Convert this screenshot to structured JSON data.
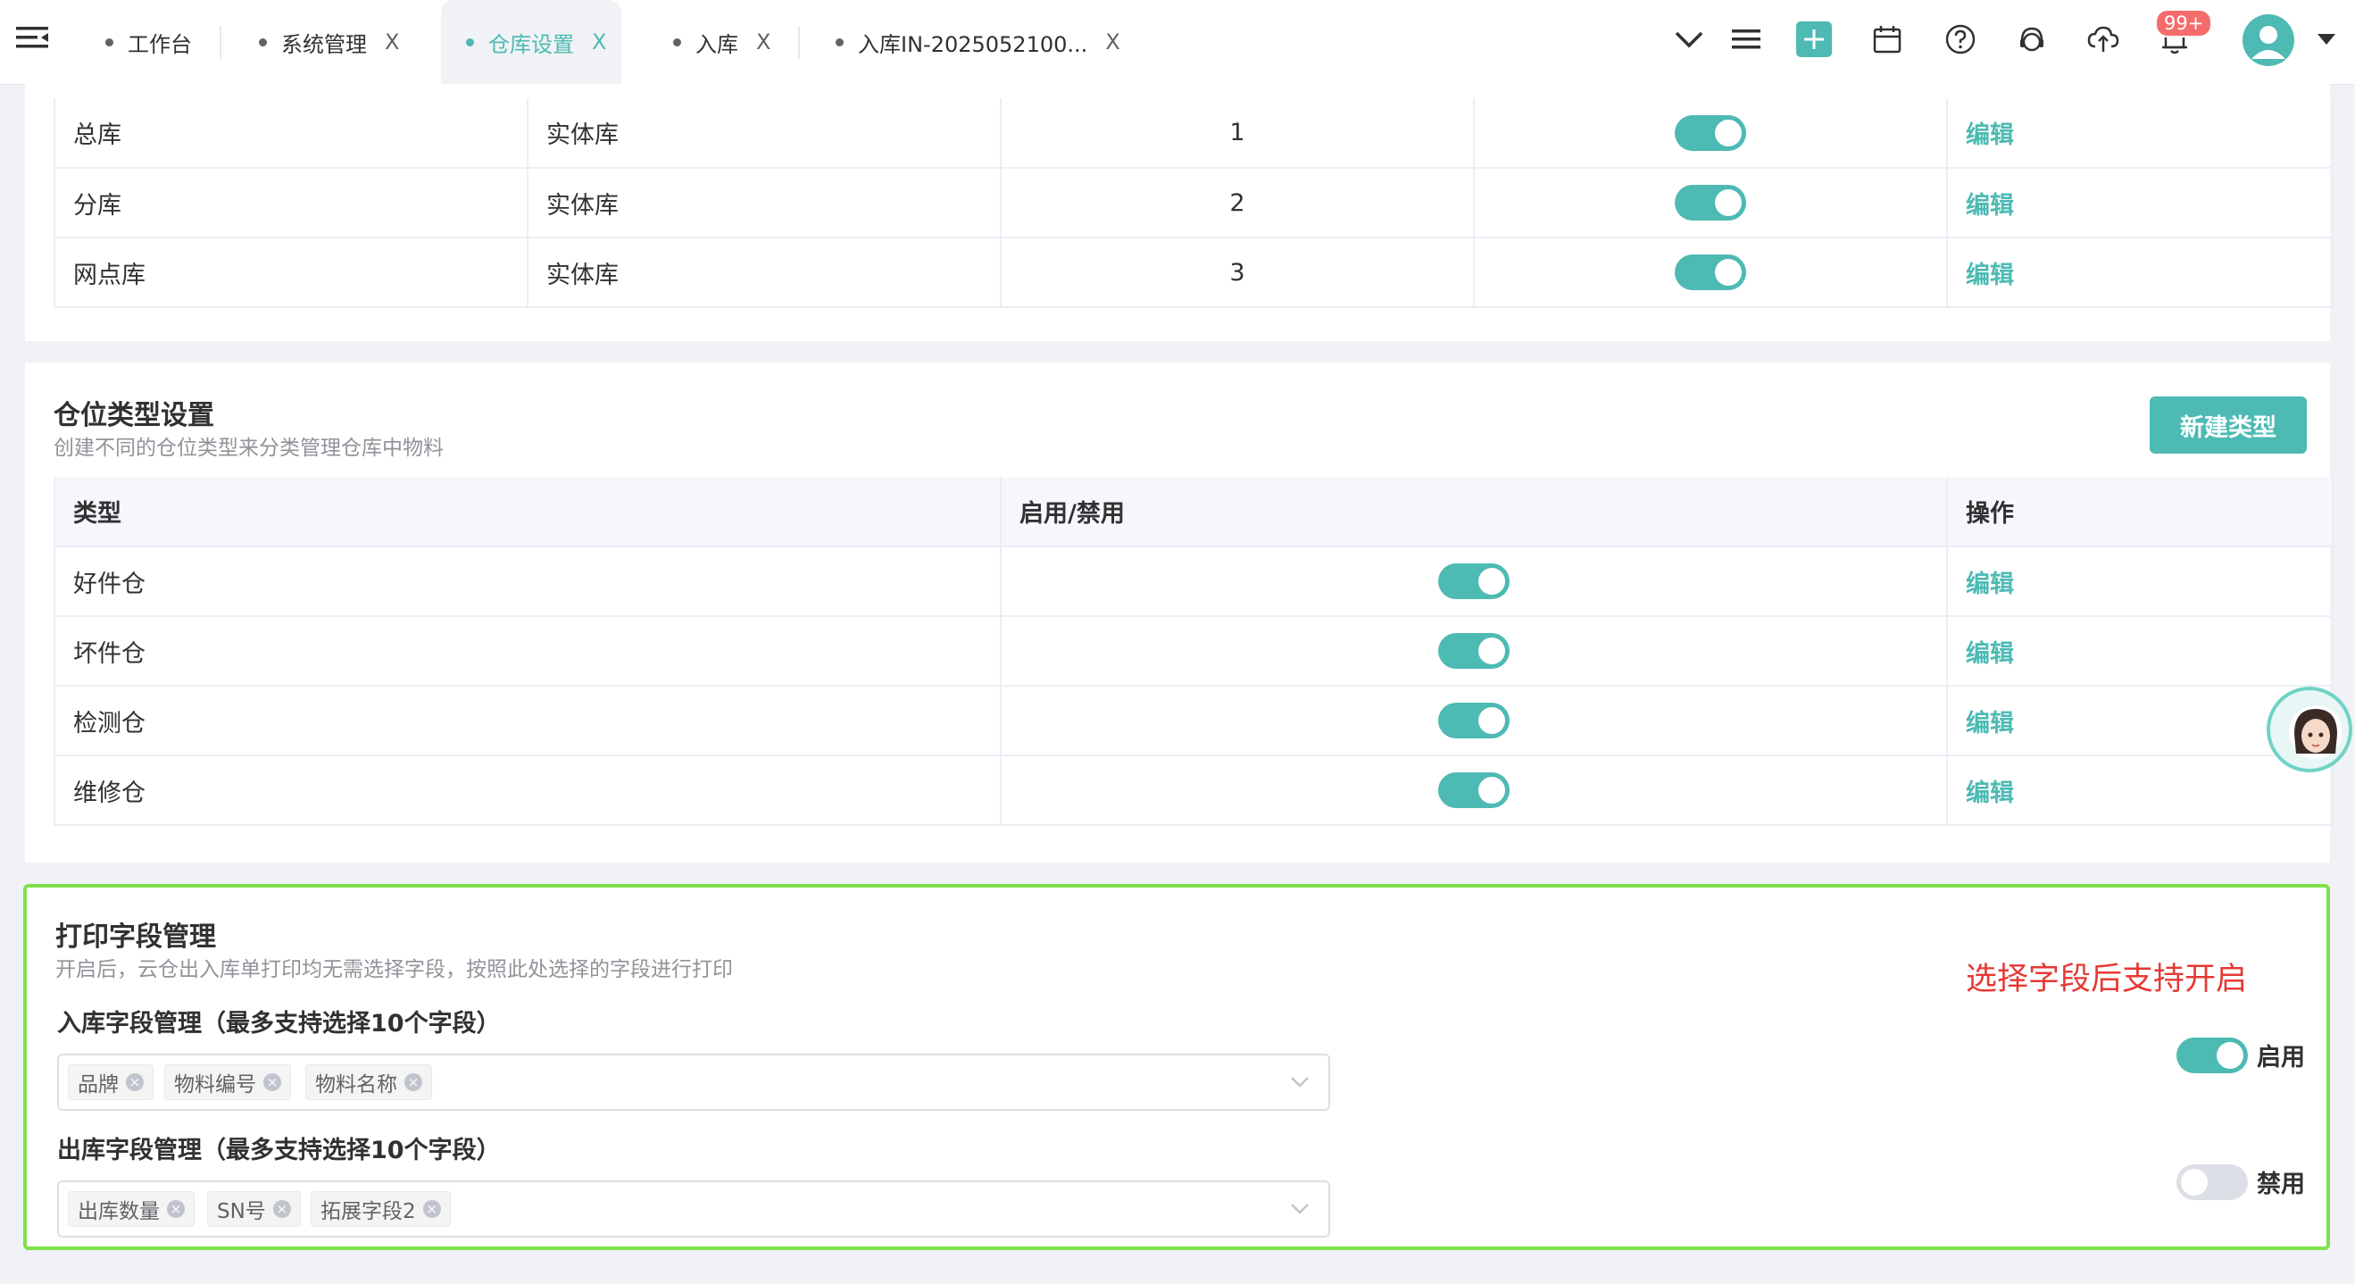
{
  "colors": {
    "accent": "#4dbab3",
    "highlight_border": "#7ee04b",
    "note_red": "#e53935",
    "badge_red": "#f56c6c"
  },
  "tabs": [
    {
      "label": "工作台",
      "closable": false,
      "active": false
    },
    {
      "label": "系统管理",
      "closable": true,
      "active": false
    },
    {
      "label": "仓库设置",
      "closable": true,
      "active": true
    },
    {
      "label": "入库",
      "closable": true,
      "active": false
    },
    {
      "label": "入库IN-2025052100...",
      "closable": true,
      "active": false
    }
  ],
  "close_glyph": "X",
  "header_icons": [
    "chevron-down-icon",
    "list-menu-icon",
    "add-icon",
    "calendar-icon",
    "help-icon",
    "support-icon",
    "cloud-upload-icon",
    "bell-icon",
    "avatar",
    "dropdown-caret-icon"
  ],
  "notification_badge": "99+",
  "warehouse_table": {
    "rows": [
      {
        "name": "总库",
        "type": "实体库",
        "order": "1",
        "enabled": true,
        "action": "编辑"
      },
      {
        "name": "分库",
        "type": "实体库",
        "order": "2",
        "enabled": true,
        "action": "编辑"
      },
      {
        "name": "网点库",
        "type": "实体库",
        "order": "3",
        "enabled": true,
        "action": "编辑"
      }
    ]
  },
  "location_types": {
    "title": "仓位类型设置",
    "description": "创建不同的仓位类型来分类管理仓库中物料",
    "new_button": "新建类型",
    "columns": [
      "类型",
      "启用/禁用",
      "操作"
    ],
    "rows": [
      {
        "type": "好件仓",
        "enabled": true,
        "action": "编辑"
      },
      {
        "type": "坏件仓",
        "enabled": true,
        "action": "编辑"
      },
      {
        "type": "检测仓",
        "enabled": true,
        "action": "编辑"
      },
      {
        "type": "维修仓",
        "enabled": true,
        "action": "编辑"
      }
    ]
  },
  "print_fields": {
    "title": "打印字段管理",
    "description": "开启后，云仓出入库单打印均无需选择字段，按照此处选择的字段进行打印",
    "note": "选择字段后支持开启",
    "inbound": {
      "label": "入库字段管理（最多支持选择10个字段）",
      "tags": [
        "品牌",
        "物料编号",
        "物料名称"
      ],
      "enabled": true,
      "status": "启用"
    },
    "outbound": {
      "label": "出库字段管理（最多支持选择10个字段）",
      "tags": [
        "出库数量",
        "SN号",
        "拓展字段2"
      ],
      "enabled": false,
      "status": "禁用"
    }
  }
}
